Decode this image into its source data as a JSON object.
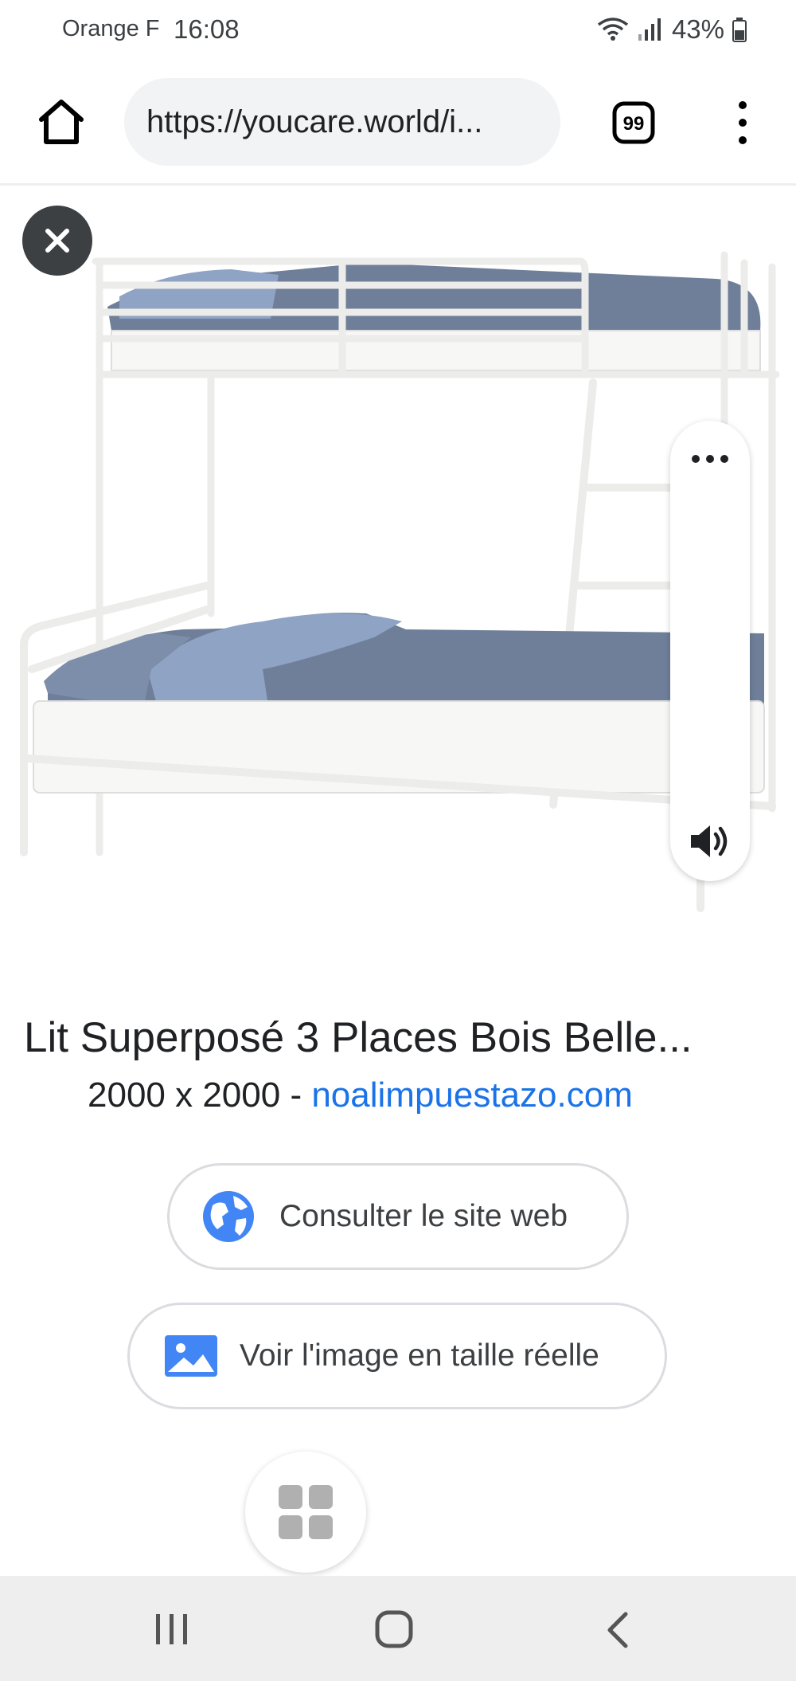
{
  "status_bar": {
    "carrier": "Orange F",
    "time": "16:08",
    "battery": "43%"
  },
  "browser": {
    "url": "https://youcare.world/i...",
    "tab_count": "99"
  },
  "image": {
    "alt": "Lit superposé métallique blanc avec housses de couette bleues",
    "colors": {
      "frame": "#f4f4f2",
      "bedding": "#6f7f9a",
      "pillow": "#8fa3c4",
      "mattress": "#f7f7f5"
    }
  },
  "result": {
    "title": "Lit Superposé 3 Places Bois Belle...",
    "dimensions": "2000 x 2000 - ",
    "site": "noalimpuestazo.com"
  },
  "actions": {
    "visit": "Consulter le site web",
    "full_size": "Voir l'image en taille réelle"
  },
  "colors": {
    "link": "#1a73e8",
    "pill_bg": "#f1f3f4",
    "nav_bg": "#eeeeee"
  }
}
